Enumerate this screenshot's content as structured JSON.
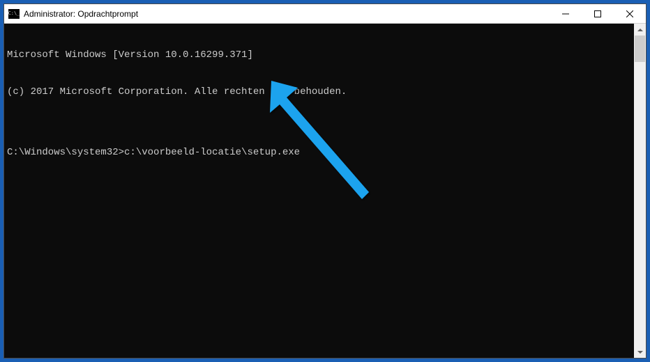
{
  "window": {
    "title": "Administrator: Opdrachtprompt"
  },
  "terminal": {
    "line1": "Microsoft Windows [Version 10.0.16299.371]",
    "line2": "(c) 2017 Microsoft Corporation. Alle rechten voorbehouden.",
    "blank": "",
    "prompt": "C:\\Windows\\system32>",
    "command": "c:\\voorbeeld-locatie\\setup.exe"
  }
}
